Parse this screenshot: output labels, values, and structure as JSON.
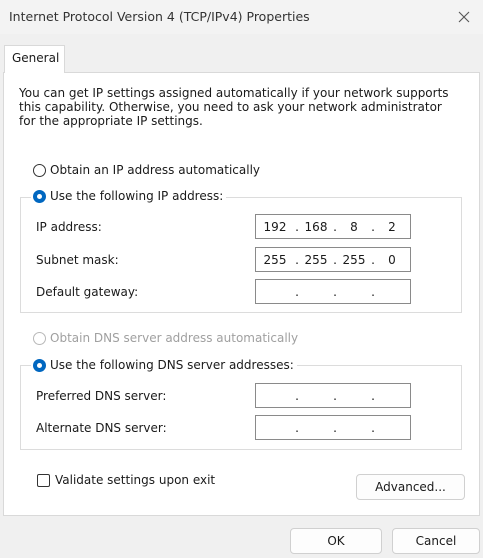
{
  "window": {
    "title": "Internet Protocol Version 4 (TCP/IPv4) Properties",
    "close_icon": "close-icon"
  },
  "tabs": [
    {
      "label": "General"
    }
  ],
  "intro": "You can get IP settings assigned automatically if your network supports this capability. Otherwise, you need to ask your network administrator for the appropriate IP settings.",
  "ip": {
    "auto_label": "Obtain an IP address automatically",
    "manual_label": "Use the following IP address:",
    "selected": "manual",
    "address_label": "IP address:",
    "address": [
      "192",
      "168",
      "8",
      "2"
    ],
    "subnet_label": "Subnet mask:",
    "subnet": [
      "255",
      "255",
      "255",
      "0"
    ],
    "gateway_label": "Default gateway:",
    "gateway": [
      "",
      "",
      "",
      ""
    ]
  },
  "dns": {
    "auto_label": "Obtain DNS server address automatically",
    "manual_label": "Use the following DNS server addresses:",
    "selected": "manual",
    "preferred_label": "Preferred DNS server:",
    "preferred": [
      "",
      "",
      "",
      ""
    ],
    "alternate_label": "Alternate DNS server:",
    "alternate": [
      "",
      "",
      "",
      ""
    ]
  },
  "validate_label": "Validate settings upon exit",
  "advanced_label": "Advanced...",
  "ok_label": "OK",
  "cancel_label": "Cancel",
  "colors": {
    "accent": "#0067c0",
    "disabled": "#a0a0a0"
  }
}
